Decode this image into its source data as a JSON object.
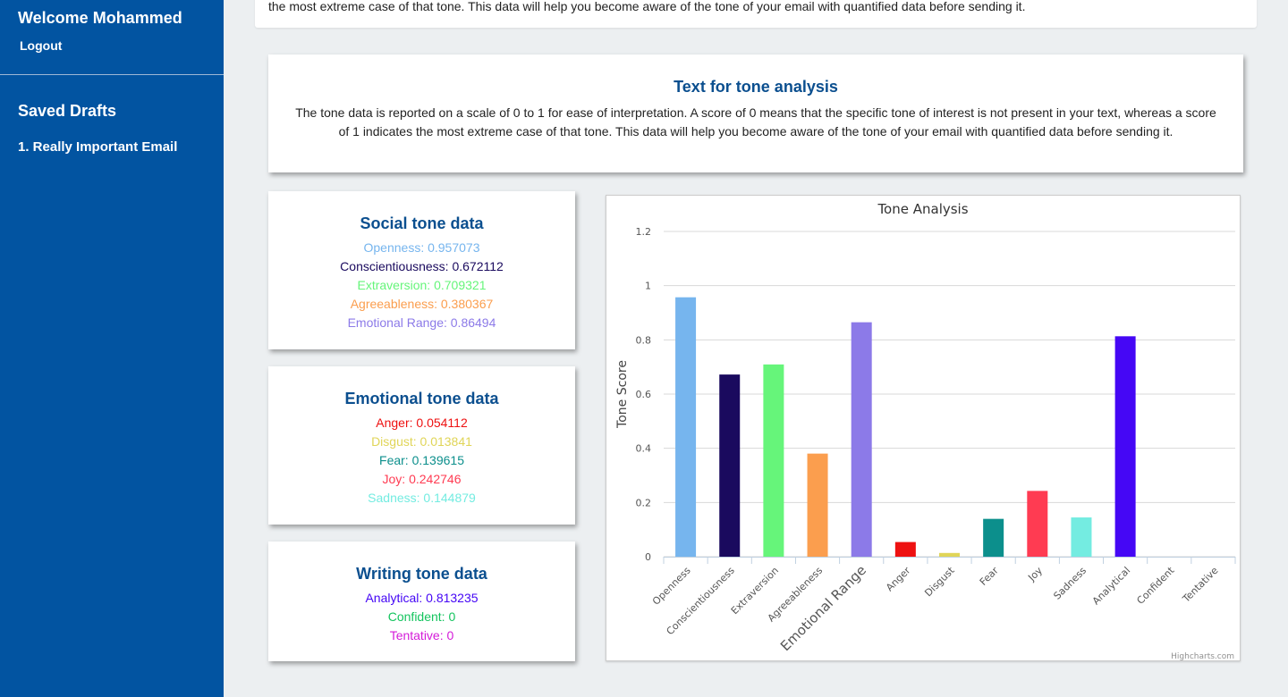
{
  "sidebar": {
    "welcome": "Welcome Mohammed",
    "logout": "Logout",
    "drafts_title": "Saved Drafts",
    "drafts": [
      "1. Really Important Email"
    ]
  },
  "top_card": {
    "text": "the most extreme case of that tone. This data will help you become aware of the tone of your email with quantified data before sending it."
  },
  "intro": {
    "title": "Text for tone analysis",
    "body": "The tone data is reported on a scale of 0 to 1 for ease of interpretation. A score of 0 means that the specific tone of interest is not present in your text, whereas a score of 1 indicates the most extreme case of that tone. This data will help you become aware of the tone of your email with quantified data before sending it."
  },
  "social": {
    "title": "Social tone data",
    "items": [
      {
        "text": "Openness: 0.957073",
        "color": "#76b5ee"
      },
      {
        "text": "Conscientiousness: 0.672112",
        "color": "#1a0a5e"
      },
      {
        "text": "Extraversion: 0.709321",
        "color": "#66f57a"
      },
      {
        "text": "Agreeableness: 0.380367",
        "color": "#fb9e4e"
      },
      {
        "text": "Emotional Range: 0.86494",
        "color": "#8c7ae8"
      }
    ]
  },
  "emotional": {
    "title": "Emotional tone data",
    "items": [
      {
        "text": "Anger: 0.054112",
        "color": "#ee1111"
      },
      {
        "text": "Disgust: 0.013841",
        "color": "#e0d558"
      },
      {
        "text": "Fear: 0.139615",
        "color": "#0c8f8c"
      },
      {
        "text": "Joy: 0.242746",
        "color": "#ff3b52"
      },
      {
        "text": "Sadness: 0.144879",
        "color": "#74ece1"
      }
    ]
  },
  "writing": {
    "title": "Writing tone data",
    "items": [
      {
        "text": "Analytical: 0.813235",
        "color": "#4507f5"
      },
      {
        "text": "Confident: 0",
        "color": "#14c45e"
      },
      {
        "text": "Tentative: 0",
        "color": "#d41bd9"
      }
    ]
  },
  "chart_data": {
    "type": "bar",
    "title": "Tone Analysis",
    "ylabel": "Tone Score",
    "xlabel": "",
    "ylim": [
      0,
      1.2
    ],
    "yticks": [
      "0",
      "0.2",
      "0.4",
      "0.6",
      "0.8",
      "1",
      "1.2"
    ],
    "grid": true,
    "credit": "Highcharts.com",
    "categories": [
      "Openness",
      "Conscientiousness",
      "Extraversion",
      "Agreeableness",
      "Emotional Range",
      "Anger",
      "Disgust",
      "Fear",
      "Joy",
      "Sadness",
      "Analytical",
      "Confident",
      "Tentative"
    ],
    "values": [
      0.957073,
      0.672112,
      0.709321,
      0.380367,
      0.86494,
      0.054112,
      0.013841,
      0.139615,
      0.242746,
      0.144879,
      0.813235,
      0,
      0
    ],
    "colors": [
      "#76b5ee",
      "#1a0a5e",
      "#66f57a",
      "#fb9e4e",
      "#8c7ae8",
      "#ee1111",
      "#e0d558",
      "#0c8f8c",
      "#ff3b52",
      "#74ece1",
      "#4507f5",
      "#14c45e",
      "#d41bd9"
    ]
  }
}
